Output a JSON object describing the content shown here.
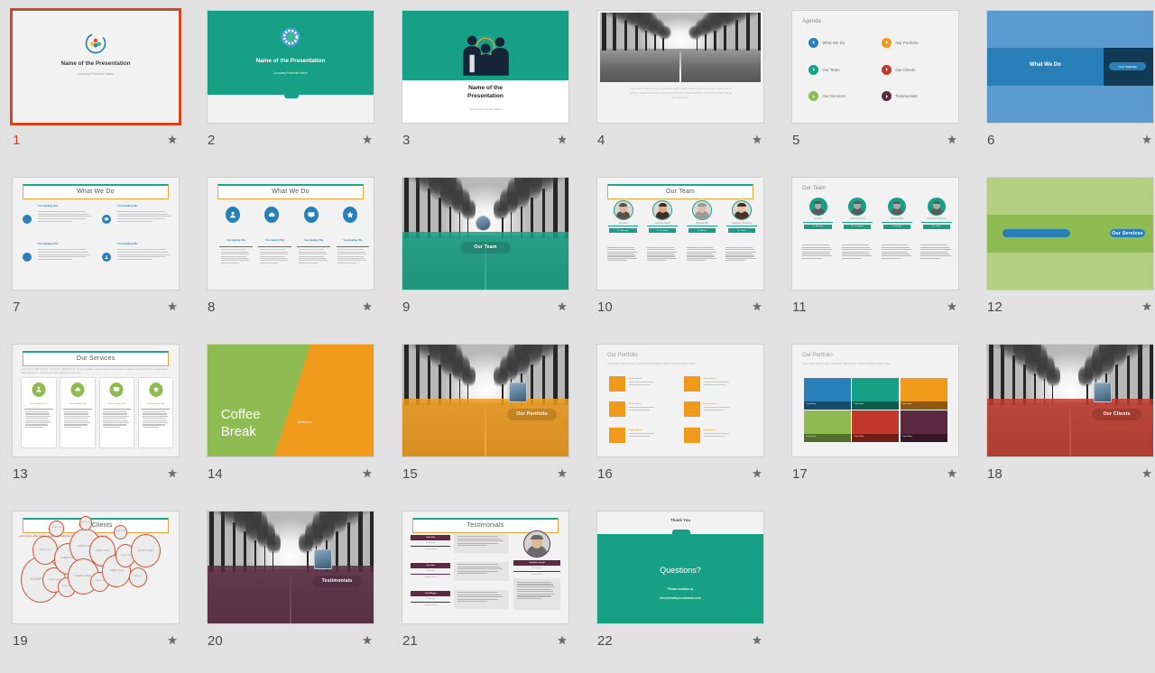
{
  "app": {
    "view": "slide-sorter",
    "background_color": "#e2e2e2",
    "selection_color": "#d6431c",
    "total_slides": 22
  },
  "theme": {
    "teal": "#16a085",
    "blue": "#2980b9",
    "light_blue": "#5b9bd0",
    "dark_navy": "#123a54",
    "orange": "#ef9a1a",
    "green": "#8fbc52",
    "red": "#c0392b",
    "purple": "#5b2a40",
    "gray_bg": "#f2f2f2",
    "title_underline": "#e8a33d",
    "title_topline": "#1aa98c"
  },
  "common": {
    "star_icon": "star-icon",
    "lorem_short": "Lorem ipsum dolor sit amet, consectetur adipiscing elit. Vivamus porttitor congue massa.",
    "lorem_long": "Lorem ipsum dolor sit amet, consectetur adipiscing elit. Vivamus porttitor congue massa. Fusce posuere, magna sed pulvinar ultricies, purus lectus malesuada libero, sit amet commodo magna eros quis urna.",
    "your_heading_title": "Your Heading Title",
    "your_subtitle": "Your Subtitle"
  },
  "slides": [
    {
      "n": 1,
      "type": "title-light",
      "title": "Name of the Presentation",
      "subtitle": "Company Presenter Name",
      "star": true,
      "selected": true
    },
    {
      "n": 2,
      "type": "title-teal",
      "title": "Name of the Presentation",
      "subtitle": "Company Presenter Name",
      "star": true
    },
    {
      "n": 3,
      "type": "title-people",
      "title": "Name of the Presentation",
      "subtitle": "Company Presenter Name",
      "star": true
    },
    {
      "n": 4,
      "type": "photo-caption",
      "caption": "Lorem ipsum dolor sit amet, consectetur adipiscing elit. Vivamus porttitor congue massa. Fusce posuere, magna sed pulvinar ultricies, purus lectus malesuada libero, sit amet commodo magna eros quis urna.",
      "star": true
    },
    {
      "n": 5,
      "type": "agenda",
      "title": "Agenda",
      "items": [
        {
          "label": "What We Do",
          "color": "#2980b9"
        },
        {
          "label": "Our Portfolio",
          "color": "#ef9a1a"
        },
        {
          "label": "Our Team",
          "color": "#16a085"
        },
        {
          "label": "Our Clients",
          "color": "#c0392b"
        },
        {
          "label": "Our Services",
          "color": "#8fbc52"
        },
        {
          "label": "Testimonials",
          "color": "#5b2a40"
        }
      ],
      "star": true
    },
    {
      "n": 6,
      "type": "divider-band",
      "title": "What We Do",
      "subtitle": "Your Subtitle",
      "color": "#5b9bd0",
      "band": "#2980b9",
      "box": "#123a54",
      "star": true
    },
    {
      "n": 7,
      "type": "whatwedo-list",
      "title": "What We Do",
      "heading": "Your Heading Title",
      "body": "Lorem ipsum dolor sit amet, consectetur adipiscing elit. Vivamus porttitor congue massa. Fusce posuere, magna sed pulvinar ultricies, purus lectus malesuada libero, sit amet commodo magna eros quis urna.",
      "star": true
    },
    {
      "n": 8,
      "type": "whatwedo-icons",
      "title": "What We Do",
      "heading": "Your Heading Title",
      "body": "Lorem ipsum dolor sit amet, consectetur adipiscing elit. Vivamus porttitor congue massa.",
      "icons": [
        "person-icon",
        "cloud-icon",
        "monitor-icon",
        "star-icon"
      ],
      "star": true
    },
    {
      "n": 9,
      "type": "divider-photo",
      "label": "Our Team",
      "color": "#16a085",
      "star": true
    },
    {
      "n": 10,
      "type": "team-photos",
      "title": "Our Team",
      "members": [
        {
          "name": "Jane Doe",
          "role": "Sr. Manager"
        },
        {
          "name": "Jonathan Joseph",
          "role": "Sr. Developer"
        },
        {
          "name": "Michaela Bird",
          "role": "Sr. Analyst"
        },
        {
          "name": "Josephine Thompson",
          "role": "Sr. Tester"
        }
      ],
      "star": true
    },
    {
      "n": 11,
      "type": "team-avatars",
      "title": "Our Team",
      "members": [
        {
          "name": "Jane Doe",
          "role": "Sr. Manager"
        },
        {
          "name": "Jonathan Joseph",
          "role": "Sr. Developer"
        },
        {
          "name": "Michaela Bird",
          "role": "Sr. Analyst"
        },
        {
          "name": "Josephine Thompson",
          "role": "Sr. Tester"
        }
      ],
      "star": true
    },
    {
      "n": 12,
      "type": "divider-band",
      "title": "Our Services",
      "subtitle": "Our Services",
      "color": "#b4cf7f",
      "band": "#8fbc52",
      "box": "#8fbc52",
      "star": true
    },
    {
      "n": 13,
      "type": "services-cards",
      "title": "Our Services",
      "intro": "Lorem ipsum dolor sit amet, consectetur adipiscing elit. Vivamus porttitor congue massa. Fusce posuere, magna sed pulvinar ultricies, purus lectus malesuada libero, sit amet commodo magna eros quis urna.",
      "heading": "Your Heading Title",
      "icons": [
        "person-icon",
        "cloud-icon",
        "monitor-icon",
        "star-icon"
      ],
      "star": true
    },
    {
      "n": 14,
      "type": "coffee-break",
      "title": "Coffee Break",
      "subtitle": "15 Minutes",
      "star": true
    },
    {
      "n": 15,
      "type": "divider-photo",
      "label": "Our Portfolio",
      "color": "#ef9a1a",
      "star": true
    },
    {
      "n": 16,
      "type": "portfolio-list",
      "title": "Our Portfolio",
      "intro": "Lorem ipsum dolor sit amet, consectetur adipiscing elit. Vivamus porttitor congue massa.",
      "item_title": "Project Name",
      "star": true
    },
    {
      "n": 17,
      "type": "portfolio-grid",
      "title": "Our Portfolio",
      "intro": "Lorem ipsum dolor sit amet, consectetur adipiscing elit. Vivamus porttitor congue massa.",
      "item_title": "Project Name",
      "tiles": [
        "#2980b9",
        "#16a085",
        "#ef9a1a",
        "#8fbc52",
        "#c0392b",
        "#5b2a40"
      ],
      "star": true
    },
    {
      "n": 18,
      "type": "divider-photo",
      "label": "Our Clients",
      "color": "#c0392b",
      "star": true
    },
    {
      "n": 19,
      "type": "clients-bubbles",
      "title": "Our Clients",
      "intro": "Lorem ipsum dolor sit amet, consectetur adipiscing elit. Vivamus porttitor congue massa.",
      "bubble_label": "CLIENT LOGO",
      "star": true
    },
    {
      "n": 20,
      "type": "divider-photo",
      "label": "Testimonials",
      "color": "#5b2a40",
      "star": true
    },
    {
      "n": 21,
      "type": "testimonials",
      "title": "Testimonials",
      "entries": [
        {
          "name": "John Doe",
          "role": "Sr. Manager",
          "company": "Company Name"
        },
        {
          "name": "Jane Doe",
          "role": "Sr. Manager",
          "company": "Company Name"
        },
        {
          "name": "Jane Bloggs",
          "role": "Sr. Manager",
          "company": "Company Name"
        }
      ],
      "featured": {
        "name": "Jonathan Joseph",
        "role": "Sr. Manager",
        "company": "Company Name"
      },
      "star": true
    },
    {
      "n": 22,
      "type": "thank-you",
      "title": "Thank You",
      "headline": "Questions?",
      "line1": "Please contact us",
      "line2": "info@emailyourdomain.com",
      "star": true
    }
  ]
}
